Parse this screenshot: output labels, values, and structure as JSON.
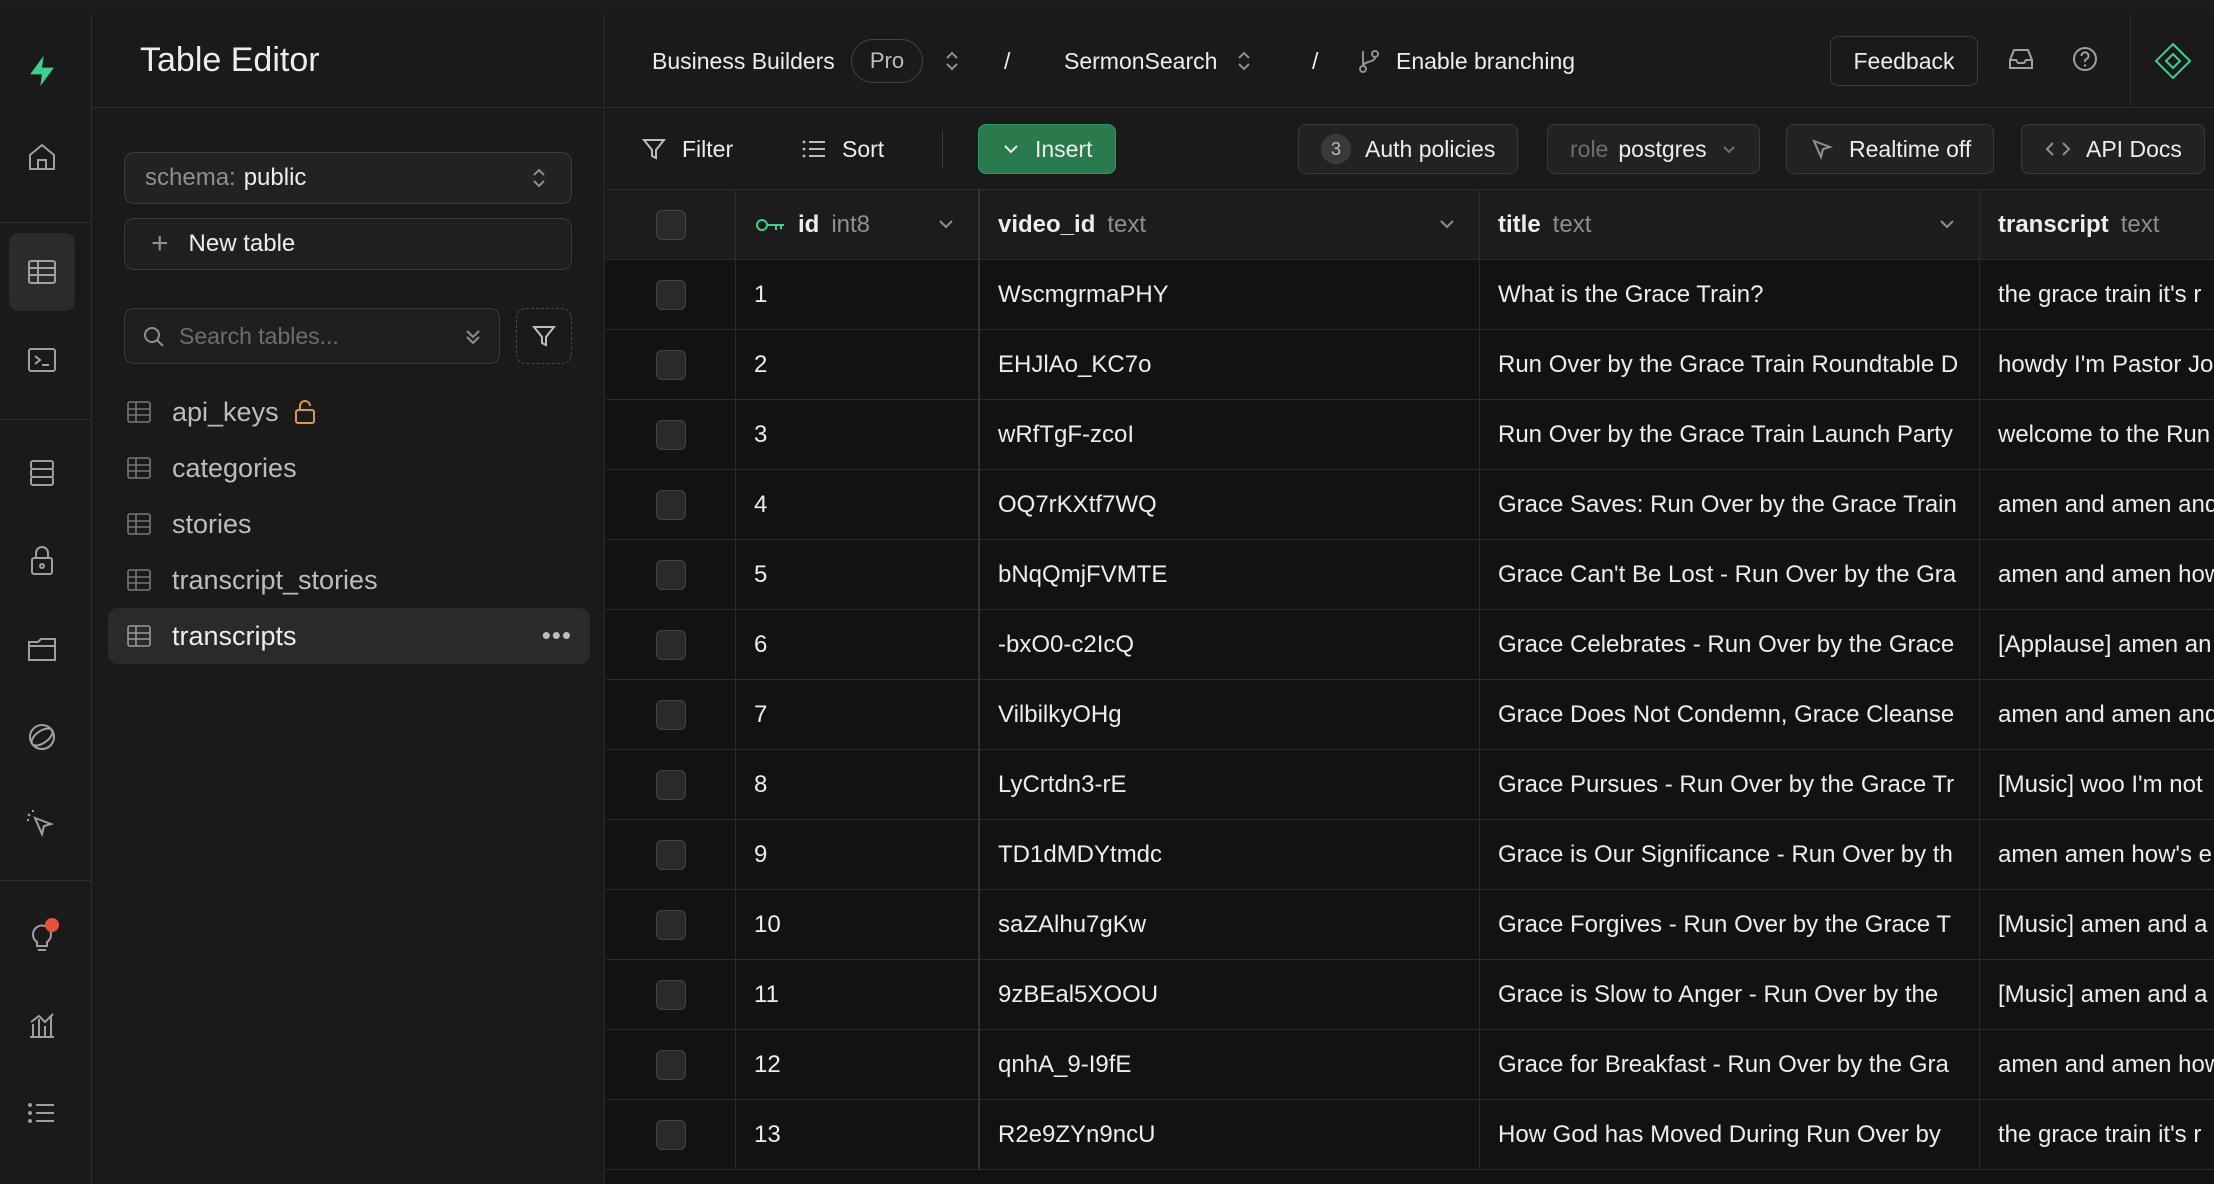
{
  "sidebar": {
    "title": "Table Editor",
    "schema_label": "schema:",
    "schema_value": "public",
    "new_table_label": "New table",
    "search_placeholder": "Search tables...",
    "tables": [
      {
        "name": "api_keys",
        "locked": true
      },
      {
        "name": "categories",
        "locked": false
      },
      {
        "name": "stories",
        "locked": false
      },
      {
        "name": "transcript_stories",
        "locked": false
      },
      {
        "name": "transcripts",
        "locked": false,
        "active": true
      }
    ]
  },
  "topnav": {
    "org": "Business Builders",
    "plan": "Pro",
    "project": "SermonSearch",
    "branching": "Enable branching",
    "feedback": "Feedback"
  },
  "toolbar": {
    "filter": "Filter",
    "sort": "Sort",
    "insert": "Insert",
    "auth_count": "3",
    "auth_policies": "Auth policies",
    "role_label": "role",
    "role_value": "postgres",
    "realtime": "Realtime off",
    "api_docs": "API Docs"
  },
  "columns": [
    {
      "name": "id",
      "type": "int8"
    },
    {
      "name": "video_id",
      "type": "text"
    },
    {
      "name": "title",
      "type": "text"
    },
    {
      "name": "transcript",
      "type": "text"
    }
  ],
  "rows": [
    {
      "id": "1",
      "video_id": "WscmgrmaPHY",
      "title": "What is the Grace Train?",
      "transcript": "the grace train it's r"
    },
    {
      "id": "2",
      "video_id": "EHJlAo_KC7o",
      "title": "Run Over by the Grace Train Roundtable D",
      "transcript": "howdy I'm Pastor Jo"
    },
    {
      "id": "3",
      "video_id": "wRfTgF-zcoI",
      "title": "Run Over by the Grace Train Launch Party",
      "transcript": "welcome to the Run"
    },
    {
      "id": "4",
      "video_id": "OQ7rKXtf7WQ",
      "title": "Grace Saves: Run Over by the Grace Train",
      "transcript": "amen and amen and"
    },
    {
      "id": "5",
      "video_id": "bNqQmjFVMTE",
      "title": "Grace Can't Be Lost - Run Over by the Gra",
      "transcript": "amen and amen how"
    },
    {
      "id": "6",
      "video_id": "-bxO0-c2IcQ",
      "title": "Grace Celebrates - Run Over by the Grace",
      "transcript": "[Applause] amen an"
    },
    {
      "id": "7",
      "video_id": "VilbilkyOHg",
      "title": "Grace Does Not Condemn, Grace Cleanse",
      "transcript": "amen and amen and"
    },
    {
      "id": "8",
      "video_id": "LyCrtdn3-rE",
      "title": "Grace Pursues - Run Over by the Grace Tr",
      "transcript": "[Music] woo I'm not"
    },
    {
      "id": "9",
      "video_id": "TD1dMDYtmdc",
      "title": "Grace is Our Significance - Run Over by th",
      "transcript": "amen amen how's e"
    },
    {
      "id": "10",
      "video_id": "saZAlhu7gKw",
      "title": "Grace Forgives - Run Over by the Grace T",
      "transcript": "[Music] amen and a"
    },
    {
      "id": "11",
      "video_id": "9zBEal5XOOU",
      "title": "Grace is Slow to Anger - Run Over by the",
      "transcript": "[Music] amen and a"
    },
    {
      "id": "12",
      "video_id": "qnhA_9-I9fE",
      "title": "Grace for Breakfast - Run Over by the Gra",
      "transcript": "amen and amen how"
    },
    {
      "id": "13",
      "video_id": "R2e9ZYn9ncU",
      "title": "How God has Moved During Run Over by",
      "transcript": "the grace train it's r"
    }
  ],
  "colors": {
    "brand": "#3ecf8e",
    "insert_bg": "#2a7a4e",
    "lock": "#d89b3a",
    "notification": "#e5533d"
  }
}
